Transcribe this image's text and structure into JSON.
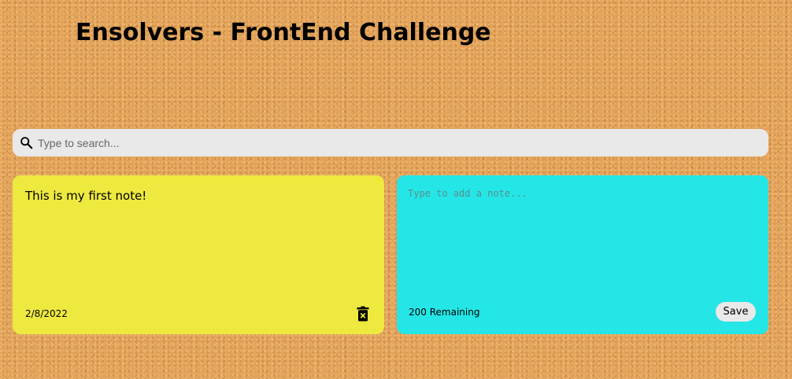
{
  "header": {
    "title": "Ensolvers - FrontEnd Challenge"
  },
  "search": {
    "placeholder": "Type to search...",
    "value": "",
    "icon": "search-icon"
  },
  "notes": [
    {
      "text": "This is my first note!",
      "date": "2/8/2022",
      "color": "#ede93f",
      "delete_icon": "trash-icon"
    }
  ],
  "add_note": {
    "placeholder": "Type to add a note...",
    "remaining": "200 Remaining",
    "save_label": "Save",
    "color": "#24e6e6"
  },
  "colors": {
    "background": "#e3a35a",
    "search_bar": "#e9e9e9"
  }
}
